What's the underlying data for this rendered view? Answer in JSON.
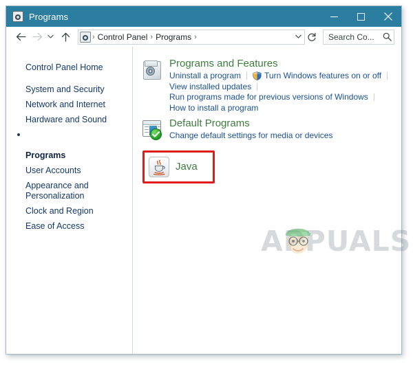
{
  "window": {
    "title": "Programs",
    "title_icon": "control-panel-icon",
    "controls": {
      "minimize": "—",
      "maximize": "□",
      "close": "✕"
    }
  },
  "navbar": {
    "back_icon": "back-arrow-icon",
    "forward_icon": "forward-arrow-icon",
    "history_icon": "recent-locations-chevron-icon",
    "up_icon": "up-arrow-icon",
    "address_icon": "control-panel-icon",
    "breadcrumbs": [
      "Control Panel",
      "Programs"
    ],
    "separator": "›",
    "dropdown_icon": "chevron-down-icon",
    "refresh_icon": "refresh-icon",
    "search": {
      "value": "Search Co...",
      "placeholder": "Search Control Panel",
      "icon": "search-icon"
    }
  },
  "sidebar": {
    "items": [
      {
        "label": "Control Panel Home",
        "current": false
      },
      {
        "label": "System and Security",
        "current": false
      },
      {
        "label": "Network and Internet",
        "current": false
      },
      {
        "label": "Hardware and Sound",
        "current": false
      },
      {
        "label": "Programs",
        "current": true
      },
      {
        "label": "User Accounts",
        "current": false
      },
      {
        "label": "Appearance and\nPersonalization",
        "current": false
      },
      {
        "label": "Clock and Region",
        "current": false
      },
      {
        "label": "Ease of Access",
        "current": false
      }
    ]
  },
  "main": {
    "sections": [
      {
        "title": "Programs and Features",
        "icon": "programs-and-features-icon",
        "links_row1": [
          {
            "label": "Uninstall a program",
            "shield": false
          },
          {
            "label": "Turn Windows features on or off",
            "shield": true
          }
        ],
        "links_row2": "View installed updates",
        "links_row3": "Run programs made for previous versions of Windows",
        "links_row4": "How to install a program"
      },
      {
        "title": "Default Programs",
        "icon": "default-programs-icon",
        "subtitle": "Change default settings for media or devices"
      }
    ],
    "java": {
      "label": "Java",
      "icon": "java-coffee-cup-icon",
      "highlight_color": "#e01b1b"
    }
  },
  "watermark": {
    "text": "APPUALS",
    "mascot": "appuals-mascot-icon"
  },
  "colors": {
    "titlebar": "#2c7ea1",
    "heading_green": "#3f7d3f",
    "link_blue": "#1a4f94",
    "sidebar_link": "#15386b",
    "highlight_red": "#e01b1b"
  }
}
